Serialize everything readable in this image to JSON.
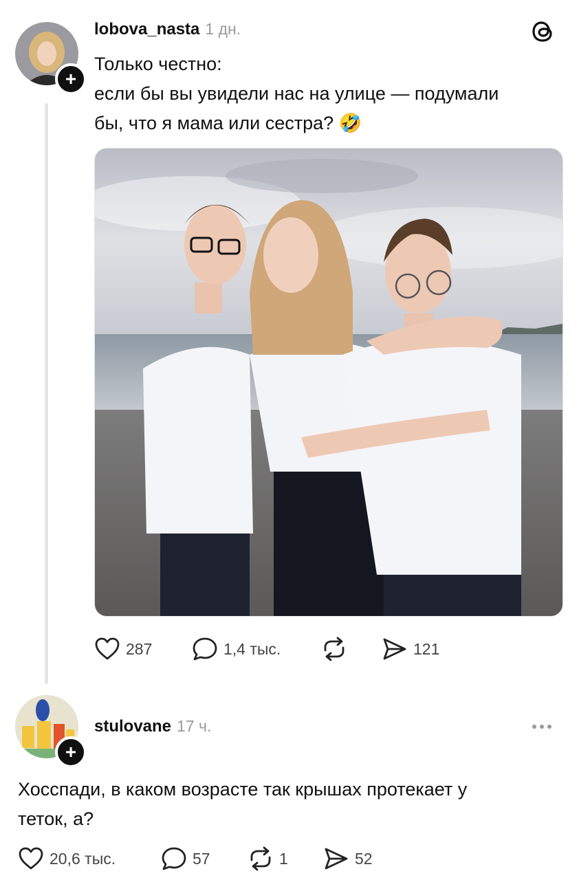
{
  "post": {
    "username": "lobova_nasta",
    "time": "1 дн.",
    "text_line1": "Только честно:",
    "text_line2": "если бы вы увидели нас на улице — подумали",
    "text_line3": "бы, что я мама или сестра?",
    "emoji": "🤣",
    "likes": "287",
    "replies": "1,4 тыс.",
    "shares": "121"
  },
  "reply": {
    "username": "stulovane",
    "time": "17 ч.",
    "text_line1": "Хосспади, в каком возрасте так крышах протекает у",
    "text_line2": "теток, а?",
    "likes": "20,6 тыс.",
    "replies": "57",
    "reposts": "1",
    "shares": "52"
  },
  "follow_symbol": "+",
  "icons": {
    "brand": "threads-logo-icon",
    "like": "heart-icon",
    "reply": "speech-bubble-icon",
    "repost": "repost-icon",
    "share": "send-icon",
    "more": "more-dots-icon"
  }
}
